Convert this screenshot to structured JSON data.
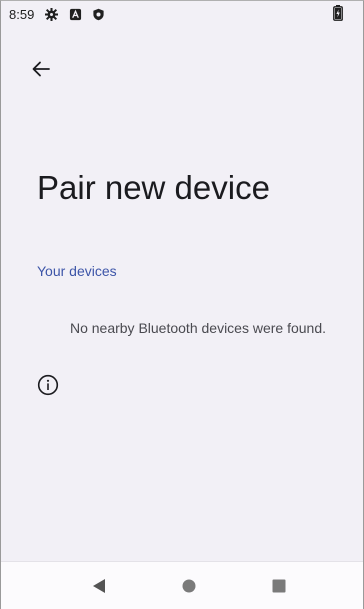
{
  "status_bar": {
    "time": "8:59",
    "icons": [
      "settings-gear-icon",
      "notification-a-icon",
      "shield-icon",
      "battery-charging-icon"
    ]
  },
  "header": {
    "title": "Pair new device"
  },
  "devices_section": {
    "header": "Your devices",
    "empty_message": "No nearby Bluetooth devices were found."
  },
  "nav_bar": {
    "buttons": [
      "back-triangle-icon",
      "home-circle-icon",
      "recents-square-icon"
    ]
  },
  "colors": {
    "background": "#f2f0f6",
    "accent": "#3d55a8",
    "text": "#1b1b1f"
  }
}
